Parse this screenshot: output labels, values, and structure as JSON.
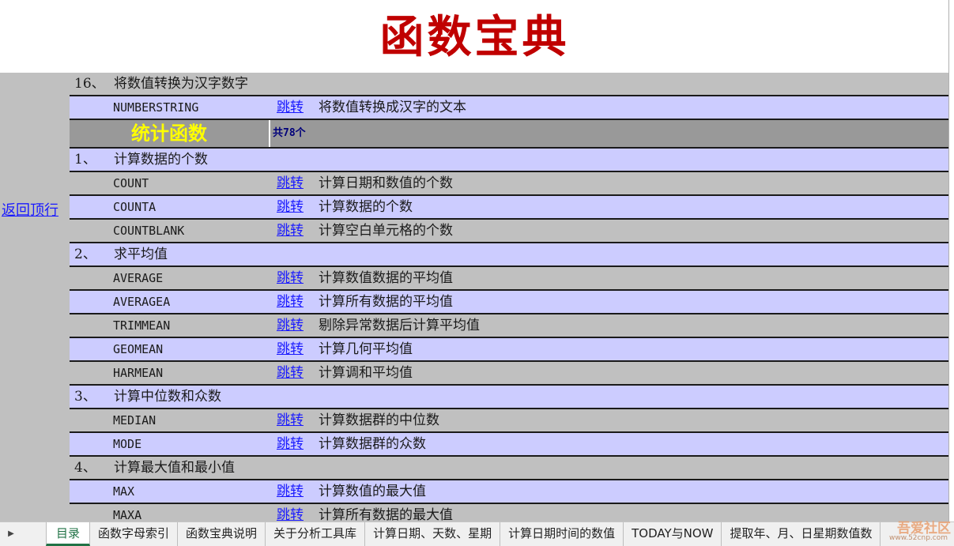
{
  "title": "函数宝典",
  "back_link": "返回顶行",
  "rows": [
    {
      "type": "category",
      "num": "16、",
      "name": "将数值转换为汉字数字",
      "bg": "grey"
    },
    {
      "type": "function",
      "name": "NUMBERSTRING",
      "jump": "跳转",
      "desc": "将数值转换成汉字的文本",
      "bg": "lav"
    },
    {
      "type": "section",
      "label": "统计函数",
      "count": "共78个"
    },
    {
      "type": "category",
      "num": "1、",
      "name": "计算数据的个数",
      "bg": "lav"
    },
    {
      "type": "function",
      "name": "COUNT",
      "jump": "跳转",
      "desc": "计算日期和数值的个数",
      "bg": "grey"
    },
    {
      "type": "function",
      "name": "COUNTA",
      "jump": "跳转",
      "desc": "计算数据的个数",
      "bg": "lav"
    },
    {
      "type": "function",
      "name": "COUNTBLANK",
      "jump": "跳转",
      "desc": "计算空白单元格的个数",
      "bg": "grey"
    },
    {
      "type": "category",
      "num": "2、",
      "name": "求平均值",
      "bg": "lav"
    },
    {
      "type": "function",
      "name": "AVERAGE",
      "jump": "跳转",
      "desc": "计算数值数据的平均值",
      "bg": "grey"
    },
    {
      "type": "function",
      "name": "AVERAGEA",
      "jump": "跳转",
      "desc": "计算所有数据的平均值",
      "bg": "lav"
    },
    {
      "type": "function",
      "name": "TRIMMEAN",
      "jump": "跳转",
      "desc": "剔除异常数据后计算平均值",
      "bg": "grey"
    },
    {
      "type": "function",
      "name": "GEOMEAN",
      "jump": "跳转",
      "desc": "计算几何平均值",
      "bg": "lav"
    },
    {
      "type": "function",
      "name": "HARMEAN",
      "jump": "跳转",
      "desc": "计算调和平均值",
      "bg": "grey"
    },
    {
      "type": "category",
      "num": "3、",
      "name": "计算中位数和众数",
      "bg": "lav"
    },
    {
      "type": "function",
      "name": "MEDIAN",
      "jump": "跳转",
      "desc": "计算数据群的中位数",
      "bg": "grey"
    },
    {
      "type": "function",
      "name": "MODE",
      "jump": "跳转",
      "desc": "计算数据群的众数",
      "bg": "lav"
    },
    {
      "type": "category",
      "num": "4、",
      "name": "计算最大值和最小值",
      "bg": "grey"
    },
    {
      "type": "function",
      "name": "MAX",
      "jump": "跳转",
      "desc": "计算数值的最大值",
      "bg": "lav"
    },
    {
      "type": "function",
      "name": "MAXA",
      "jump": "跳转",
      "desc": "计算所有数据的最大值",
      "bg": "grey"
    }
  ],
  "tabs": [
    {
      "label": "目录",
      "active": true
    },
    {
      "label": "函数字母索引",
      "active": false
    },
    {
      "label": "函数宝典说明",
      "active": false
    },
    {
      "label": "关于分析工具库",
      "active": false
    },
    {
      "label": "计算日期、天数、星期",
      "active": false
    },
    {
      "label": "计算日期时间的数值",
      "active": false
    },
    {
      "label": "TODAY与NOW",
      "active": false
    },
    {
      "label": "提取年、月、日星期数值数",
      "active": false
    }
  ],
  "watermark": "吾爱社区",
  "watermark_sub": "www.52cnp.com",
  "colors": {
    "title": "#c00000",
    "row_grey": "#c0c0c0",
    "row_lavender": "#ccccff",
    "section_bg": "#999999",
    "section_text": "#ffff00",
    "link": "#1a1aff",
    "active_tab": "#217346"
  }
}
